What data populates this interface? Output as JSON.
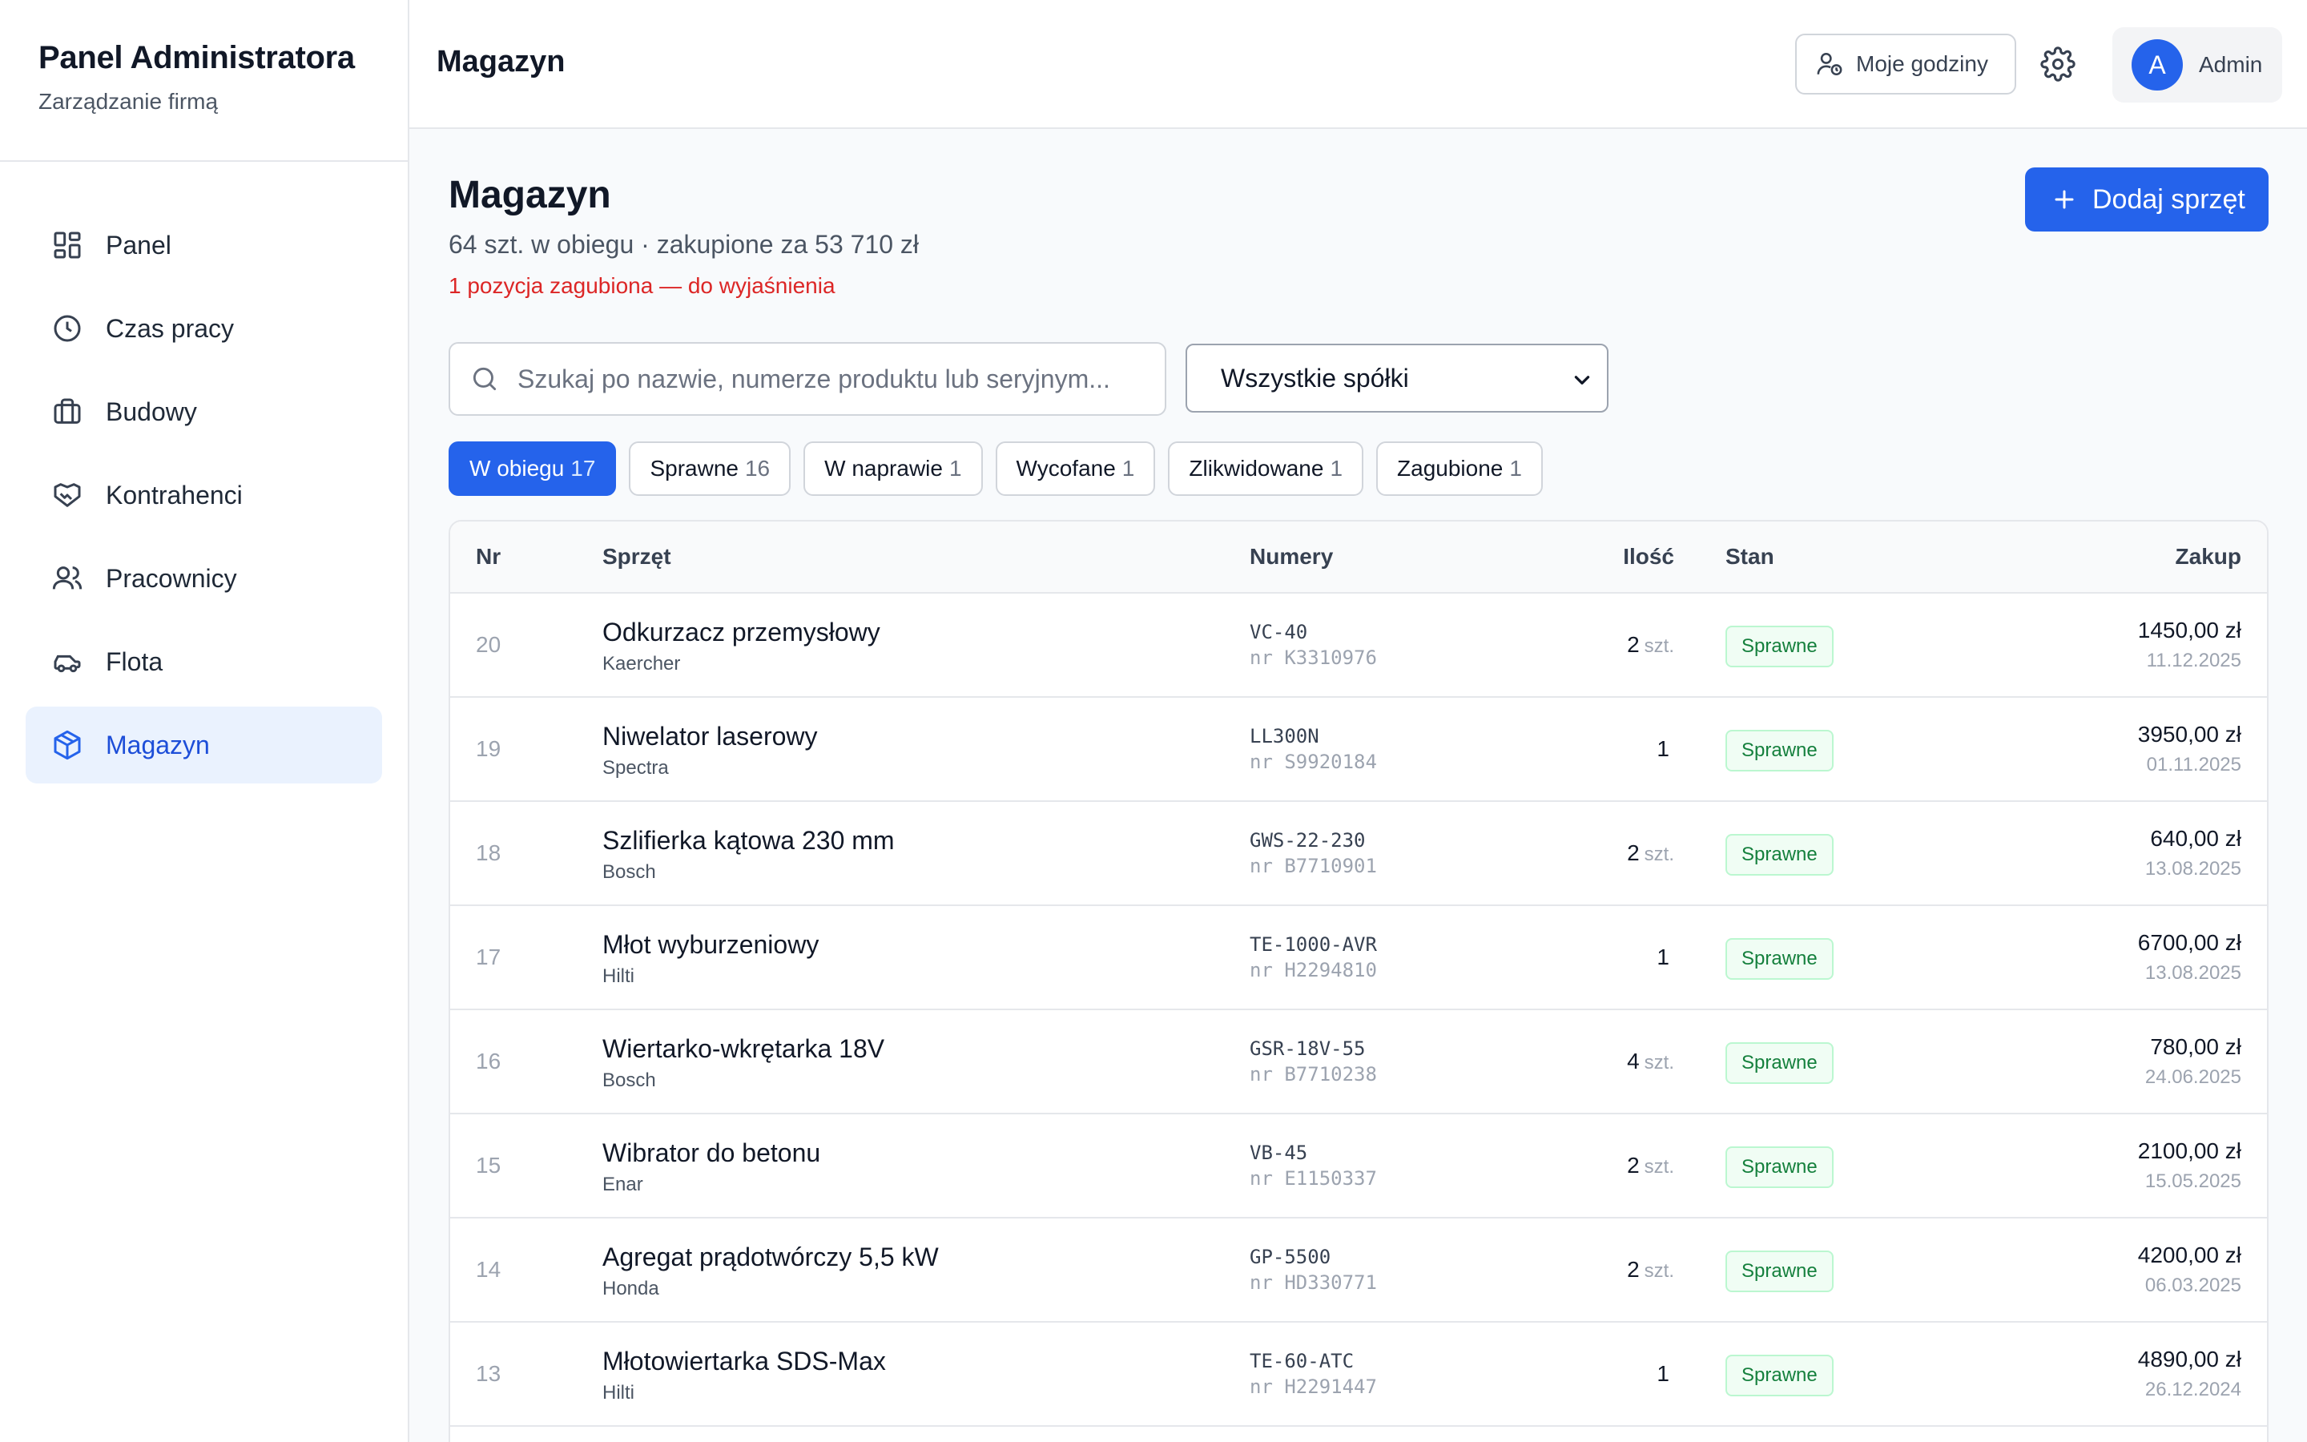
{
  "sidebar": {
    "title": "Panel Administratora",
    "subtitle": "Zarządzanie firmą",
    "items": [
      {
        "label": "Panel",
        "icon": "dashboard-icon"
      },
      {
        "label": "Czas pracy",
        "icon": "clock-icon"
      },
      {
        "label": "Budowy",
        "icon": "briefcase-icon"
      },
      {
        "label": "Kontrahenci",
        "icon": "handshake-icon"
      },
      {
        "label": "Pracownicy",
        "icon": "users-icon"
      },
      {
        "label": "Flota",
        "icon": "car-icon"
      },
      {
        "label": "Magazyn",
        "icon": "package-icon",
        "active": true
      }
    ]
  },
  "header": {
    "title": "Magazyn",
    "hours_button": "Moje godziny",
    "user_initial": "A",
    "user_name": "Admin"
  },
  "page": {
    "title": "Magazyn",
    "summary": "64 szt. w obiegu · zakupione za 53 710 zł",
    "warning": "1 pozycja zagubiona — do wyjaśnienia",
    "add_button": "Dodaj sprzęt",
    "search_placeholder": "Szukaj po nazwie, numerze produktu lub seryjnym...",
    "company_select": "Wszystkie spółki"
  },
  "filters": [
    {
      "label": "W obiegu",
      "count": "17",
      "active": true
    },
    {
      "label": "Sprawne",
      "count": "16"
    },
    {
      "label": "W naprawie",
      "count": "1"
    },
    {
      "label": "Wycofane",
      "count": "1"
    },
    {
      "label": "Zlikwidowane",
      "count": "1"
    },
    {
      "label": "Zagubione",
      "count": "1"
    }
  ],
  "table": {
    "columns": {
      "nr": "Nr",
      "item": "Sprzęt",
      "numbers": "Numery",
      "qty": "Ilość",
      "status": "Stan",
      "purchase": "Zakup"
    },
    "rows": [
      {
        "nr": "20",
        "name": "Odkurzacz przemysłowy",
        "brand": "Kaercher",
        "model": "VC-40",
        "serial": "nr K3310976",
        "qty": "2",
        "unit": "szt.",
        "status": "Sprawne",
        "price": "1450,00 zł",
        "date": "11.12.2025"
      },
      {
        "nr": "19",
        "name": "Niwelator laserowy",
        "brand": "Spectra",
        "model": "LL300N",
        "serial": "nr S9920184",
        "qty": "1",
        "unit": "",
        "status": "Sprawne",
        "price": "3950,00 zł",
        "date": "01.11.2025"
      },
      {
        "nr": "18",
        "name": "Szlifierka kątowa 230 mm",
        "brand": "Bosch",
        "model": "GWS-22-230",
        "serial": "nr B7710901",
        "qty": "2",
        "unit": "szt.",
        "status": "Sprawne",
        "price": "640,00 zł",
        "date": "13.08.2025"
      },
      {
        "nr": "17",
        "name": "Młot wyburzeniowy",
        "brand": "Hilti",
        "model": "TE-1000-AVR",
        "serial": "nr H2294810",
        "qty": "1",
        "unit": "",
        "status": "Sprawne",
        "price": "6700,00 zł",
        "date": "13.08.2025"
      },
      {
        "nr": "16",
        "name": "Wiertarko-wkrętarka 18V",
        "brand": "Bosch",
        "model": "GSR-18V-55",
        "serial": "nr B7710238",
        "qty": "4",
        "unit": "szt.",
        "status": "Sprawne",
        "price": "780,00 zł",
        "date": "24.06.2025"
      },
      {
        "nr": "15",
        "name": "Wibrator do betonu",
        "brand": "Enar",
        "model": "VB-45",
        "serial": "nr E1150337",
        "qty": "2",
        "unit": "szt.",
        "status": "Sprawne",
        "price": "2100,00 zł",
        "date": "15.05.2025"
      },
      {
        "nr": "14",
        "name": "Agregat prądotwórczy 5,5 kW",
        "brand": "Honda",
        "model": "GP-5500",
        "serial": "nr HD330771",
        "qty": "2",
        "unit": "szt.",
        "status": "Sprawne",
        "price": "4200,00 zł",
        "date": "06.03.2025"
      },
      {
        "nr": "13",
        "name": "Młotowiertarka SDS-Max",
        "brand": "Hilti",
        "model": "TE-60-ATC",
        "serial": "nr H2291447",
        "qty": "1",
        "unit": "",
        "status": "Sprawne",
        "price": "4890,00 zł",
        "date": "26.12.2024"
      }
    ]
  },
  "colors": {
    "accent": "#2563eb",
    "warning": "#dc2626",
    "status_ok": "#15803d"
  }
}
